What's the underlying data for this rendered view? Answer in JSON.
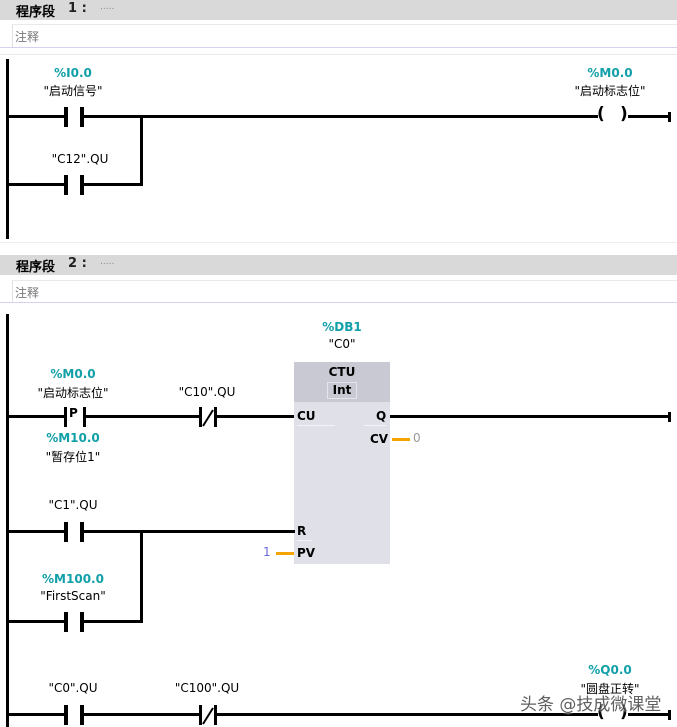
{
  "networks": [
    {
      "title": "程序段",
      "number": "1 :",
      "dots": ".....",
      "comment": "注释",
      "elements": {
        "contact1": {
          "address": "%I0.0",
          "tag": "\"启动信号\""
        },
        "contact2": {
          "tag": "\"C12\".QU"
        },
        "coil": {
          "address": "%M0.0",
          "tag": "\"启动标志位\""
        }
      }
    },
    {
      "title": "程序段",
      "number": "2 :",
      "dots": ".....",
      "comment": "注释",
      "elements": {
        "p_contact": {
          "address": "%M0.0",
          "tag": "\"启动标志位\"",
          "symbol": "P",
          "edge_address": "%M10.0",
          "edge_tag": "\"暂存位1\""
        },
        "nc_contact1": {
          "tag": "\"C10\".QU"
        },
        "counter": {
          "db_address": "%DB1",
          "db_tag": "\"C0\"",
          "type": "CTU",
          "data_type": "Int",
          "pins": {
            "cu": "CU",
            "q": "Q",
            "cv": "CV",
            "r": "R",
            "pv": "PV"
          },
          "cv_value": "0",
          "pv_value": "1"
        },
        "contact_c1": {
          "tag": "\"C1\".QU"
        },
        "contact_firstscan": {
          "address": "%M100.0",
          "tag": "\"FirstScan\""
        },
        "contact_c0": {
          "tag": "\"C0\".QU"
        },
        "nc_contact2": {
          "tag": "\"C100\".QU"
        },
        "coil2": {
          "address": "%Q0.0",
          "tag": "\"圆盘正转\""
        }
      }
    }
  ],
  "watermark": "头条 @技成微课堂"
}
